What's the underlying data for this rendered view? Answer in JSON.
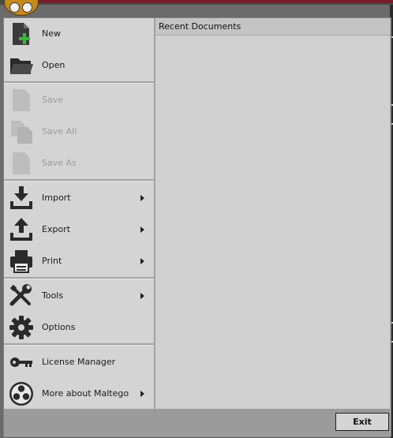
{
  "menu": {
    "items": [
      {
        "label": "New",
        "icon": "new-document-icon",
        "enabled": true,
        "submenu": false
      },
      {
        "label": "Open",
        "icon": "folder-icon",
        "enabled": true,
        "submenu": false
      },
      {
        "label": "Save",
        "icon": "save-document-icon",
        "enabled": false,
        "submenu": false
      },
      {
        "label": "Save All",
        "icon": "save-all-icon",
        "enabled": false,
        "submenu": false
      },
      {
        "label": "Save As",
        "icon": "save-as-icon",
        "enabled": false,
        "submenu": false
      },
      {
        "label": "Import",
        "icon": "import-icon",
        "enabled": true,
        "submenu": true
      },
      {
        "label": "Export",
        "icon": "export-icon",
        "enabled": true,
        "submenu": true
      },
      {
        "label": "Print",
        "icon": "printer-icon",
        "enabled": true,
        "submenu": true
      },
      {
        "label": "Tools",
        "icon": "wrench-screwdriver-icon",
        "enabled": true,
        "submenu": true
      },
      {
        "label": "Options",
        "icon": "gear-icon",
        "enabled": true,
        "submenu": false
      },
      {
        "label": "License Manager",
        "icon": "key-icon",
        "enabled": true,
        "submenu": false
      },
      {
        "label": "More about Maltego",
        "icon": "maltego-logo-icon",
        "enabled": true,
        "submenu": true
      }
    ]
  },
  "recent": {
    "title": "Recent Documents"
  },
  "footer": {
    "exit_label": "Exit"
  },
  "colors": {
    "app_button": "#c78a1a",
    "panel": "#d4d4d4",
    "disabled_text": "#9c9c9c",
    "title_accent": "#7a1d2a"
  }
}
